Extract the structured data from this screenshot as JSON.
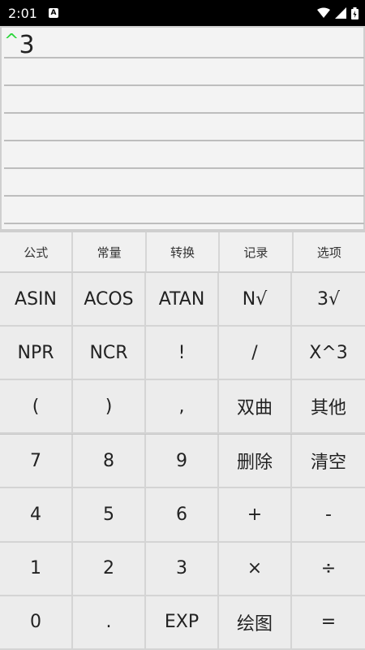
{
  "status": {
    "time": "2:01",
    "app_icon_letter": "A"
  },
  "display": {
    "caret": "^",
    "value": "3"
  },
  "tabs": [
    "公式",
    "常量",
    "转换",
    "记录",
    "选项"
  ],
  "function_keys": [
    "ASIN",
    "ACOS",
    "ATAN",
    "N√",
    "3√",
    "NPR",
    "NCR",
    "!",
    "/",
    "X^3",
    "(",
    ")",
    ",",
    "双曲",
    "其他"
  ],
  "number_keys": [
    "7",
    "8",
    "9",
    "删除",
    "清空",
    "4",
    "5",
    "6",
    "+",
    "-",
    "1",
    "2",
    "3",
    "×",
    "÷",
    "0",
    ".",
    "EXP",
    "绘图",
    "="
  ]
}
